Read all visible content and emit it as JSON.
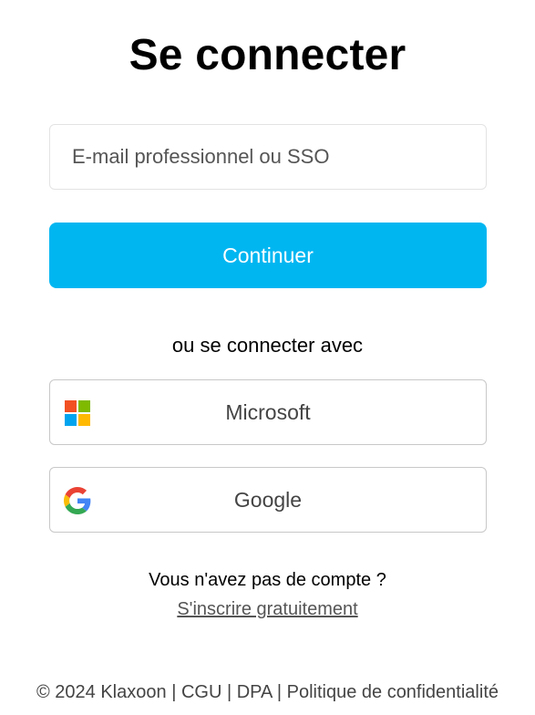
{
  "page": {
    "title": "Se connecter"
  },
  "email": {
    "placeholder": "E-mail professionnel ou SSO",
    "value": ""
  },
  "continue_label": "Continuer",
  "or_text": "ou se connecter avec",
  "providers": [
    {
      "label": "Microsoft",
      "icon": "microsoft-logo-icon",
      "colors": [
        "#f25022",
        "#7fba00",
        "#00a4ef",
        "#ffb900"
      ]
    },
    {
      "label": "Google",
      "icon": "google-logo-icon",
      "colors": [
        "#4285f4",
        "#34a853",
        "#fbbc05",
        "#ea4335"
      ]
    }
  ],
  "signup": {
    "question": "Vous n'avez pas de compte ?",
    "link": "S'inscrire gratuitement"
  },
  "footer": {
    "copyright": "© 2024 Klaxoon",
    "separator": "|",
    "links": [
      "CGU",
      "DPA",
      "Politique de confidentialité"
    ]
  },
  "colors": {
    "accent": "#00b6f1"
  }
}
